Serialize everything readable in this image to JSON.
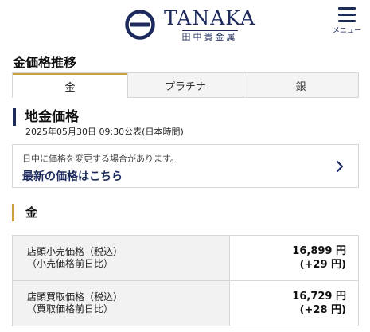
{
  "header": {
    "logo_en": "TANAKA",
    "logo_jp": "田中貴金属",
    "menu_label": "メニュー",
    "icons": {
      "logo": "tanaka-logo-mark",
      "menu": "hamburger-icon"
    },
    "colors": {
      "brand_navy": "#1c2a5c",
      "accent_gold": "#c9a13d"
    }
  },
  "page": {
    "section_title": "金価格推移"
  },
  "tabs": [
    {
      "label": "金",
      "active": true
    },
    {
      "label": "プラチナ",
      "active": false
    },
    {
      "label": "銀",
      "active": false
    }
  ],
  "gold_price": {
    "title": "地金価格",
    "published": "2025年05月30日 09:30公表(日本時間)",
    "notice": {
      "text": "日中に価格を変更する場合があります。",
      "link": "最新の価格はこちら",
      "icon": "chevron-right-icon"
    },
    "metal_heading": "金",
    "rows": [
      {
        "label_line1": "店頭小売価格（税込）",
        "label_line2": "（小売価格前日比）",
        "price": "16,899 円",
        "change": "(+29 円)"
      },
      {
        "label_line1": "店頭買取価格（税込）",
        "label_line2": "（買取価格前日比）",
        "price": "16,729 円",
        "change": "(+28 円)"
      }
    ]
  }
}
